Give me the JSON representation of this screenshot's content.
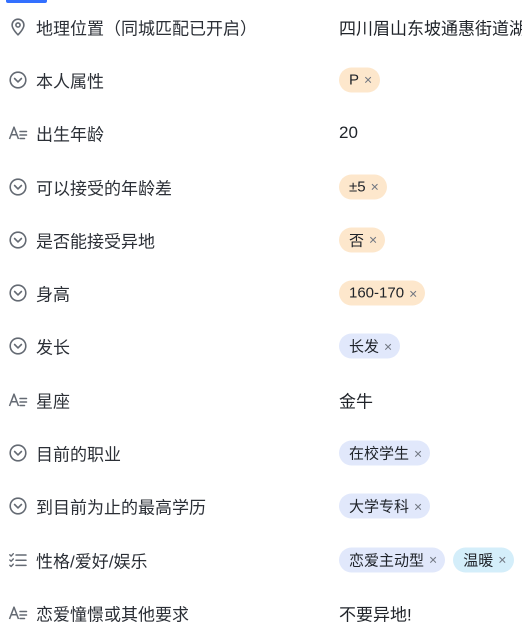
{
  "fields": [
    {
      "label": "地理位置（同城匹配已开启）",
      "icon": "location-pin-icon",
      "text": "四川眉山东坡通惠街道湖"
    },
    {
      "label": "本人属性",
      "icon": "dropdown-circle-icon",
      "tags": [
        {
          "text": "P",
          "color": "orange"
        }
      ]
    },
    {
      "label": "出生年龄",
      "icon": "text-field-icon",
      "text": "20"
    },
    {
      "label": "可以接受的年龄差",
      "icon": "dropdown-circle-icon",
      "tags": [
        {
          "text": "±5",
          "color": "orange"
        }
      ]
    },
    {
      "label": "是否能接受异地",
      "icon": "dropdown-circle-icon",
      "tags": [
        {
          "text": "否",
          "color": "orange"
        }
      ]
    },
    {
      "label": "身高",
      "icon": "dropdown-circle-icon",
      "tags": [
        {
          "text": "160-170",
          "color": "orange"
        }
      ]
    },
    {
      "label": "发长",
      "icon": "dropdown-circle-icon",
      "tags": [
        {
          "text": "长发",
          "color": "blue"
        }
      ]
    },
    {
      "label": "星座",
      "icon": "text-field-icon",
      "text": "金牛"
    },
    {
      "label": "目前的职业",
      "icon": "dropdown-circle-icon",
      "tags": [
        {
          "text": "在校学生",
          "color": "blue"
        }
      ]
    },
    {
      "label": "到目前为止的最高学历",
      "icon": "dropdown-circle-icon",
      "tags": [
        {
          "text": "大学专科",
          "color": "blue"
        }
      ]
    },
    {
      "label": "性格/爱好/娱乐",
      "icon": "multi-select-list-icon",
      "tags": [
        {
          "text": "恋爱主动型",
          "color": "blue"
        },
        {
          "text": "温暖",
          "color": "cyan"
        }
      ]
    },
    {
      "label": "恋爱憧憬或其他要求",
      "icon": "text-field-icon",
      "text": "不要异地!"
    }
  ],
  "tag_remove_symbol": "×",
  "colors": {
    "accent": "#3370ff",
    "tag_orange": "#fde7cc",
    "tag_blue": "#e1e8fb",
    "tag_cyan": "#d4eefa",
    "icon_gray": "#646a73"
  }
}
